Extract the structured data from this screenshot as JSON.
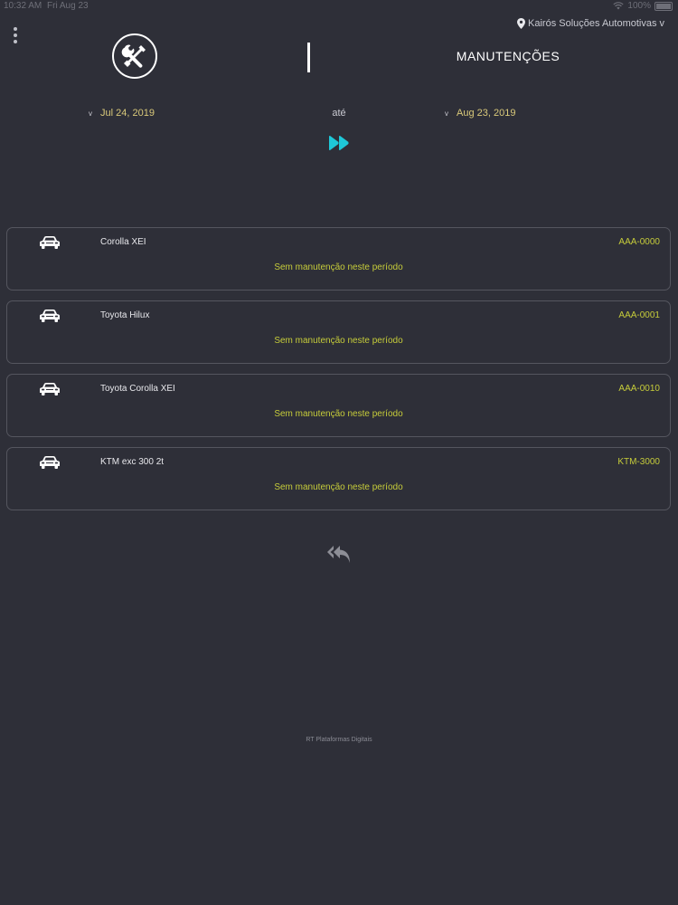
{
  "status_bar": {
    "time": "10:32 AM",
    "date": "Fri Aug 23",
    "battery": "100%"
  },
  "header": {
    "location": "Kairós Soluções Automotivas",
    "location_chevron": "v",
    "title": "MANUTENÇÕES",
    "logo_icon": "wrench-screwdriver-icon"
  },
  "date_range": {
    "start": "Jul 24, 2019",
    "separator": "até",
    "end": "Aug 23, 2019",
    "chevron": "v"
  },
  "vehicles": [
    {
      "name": "Corolla XEI",
      "plate": "AAA-0000",
      "status": "Sem manutenção neste período"
    },
    {
      "name": "Toyota Hilux",
      "plate": "AAA-0001",
      "status": "Sem manutenção neste período"
    },
    {
      "name": "Toyota Corolla XEI",
      "plate": "AAA-0010",
      "status": "Sem manutenção neste período"
    },
    {
      "name": "KTM exc 300 2t",
      "plate": "KTM-3000",
      "status": "Sem manutenção neste período"
    }
  ],
  "footer": {
    "credit": "RT Plataformas Digitais"
  },
  "colors": {
    "background": "#2e2f38",
    "accent_yellow": "#c6cc3a",
    "date_text": "#d9c97a",
    "go_button": "#1ec8d8"
  }
}
